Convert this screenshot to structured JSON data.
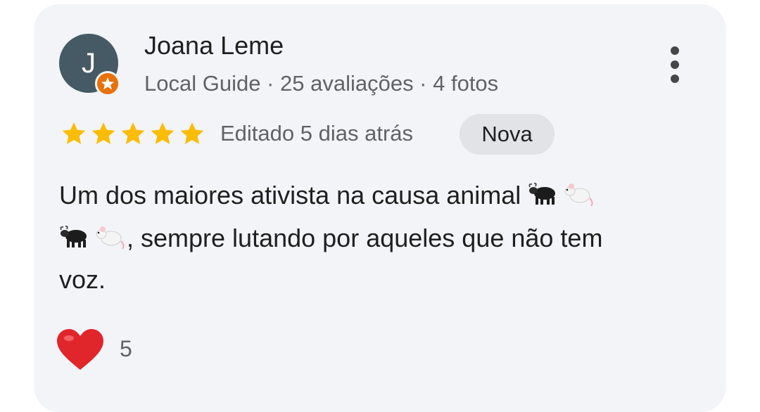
{
  "review": {
    "author": {
      "name": "Joana Leme",
      "initial": "J",
      "meta": "Local Guide · 25 avaliações · 4 fotos"
    },
    "rating": 5,
    "edited": "Editado 5 dias atrás",
    "chip": "Nova",
    "text": {
      "line1": "Um dos maiores ativista na causa animal",
      "line2": ", sempre lutando por aqueles que não tem",
      "line3": "voz."
    },
    "reaction": {
      "count": "5",
      "icon": "heart-icon"
    }
  },
  "colors": {
    "card_bg": "#f3f4f7",
    "avatar_bg": "#455a64",
    "badge": "#e8710a",
    "star": "#fbbc04",
    "chip_bg": "#e1e3e7",
    "heart": "#e0252b"
  }
}
